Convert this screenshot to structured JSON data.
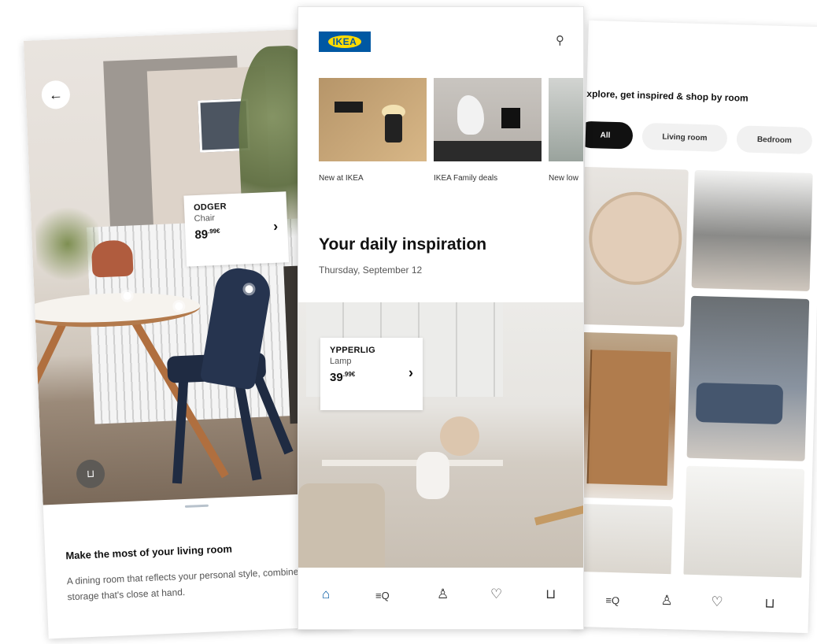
{
  "left": {
    "product": {
      "name": "ODGER",
      "type": "Chair",
      "price_main": "89",
      "price_sup": ".99€"
    },
    "title": "Make the most of your living room",
    "description": "A dining room that reflects your personal style, combined with storage that's close at hand."
  },
  "middle": {
    "logo": "IKEA",
    "categories": [
      {
        "label": "New at IKEA"
      },
      {
        "label": "IKEA Family deals"
      },
      {
        "label": "New low"
      }
    ],
    "daily_title": "Your daily inspiration",
    "daily_date": "Thursday, September 12",
    "product": {
      "name": "YPPERLIG",
      "type": "Lamp",
      "price_main": "39",
      "price_sup": ".99€"
    }
  },
  "right": {
    "title": "xplore, get inspired & shop by room",
    "pills": [
      "All",
      "Living room",
      "Bedroom"
    ]
  },
  "icons": {
    "back": "←",
    "search": "⚲",
    "home": "⌂",
    "browse": "≡Q",
    "profile": "♙",
    "wishlist": "♡",
    "cart": "⊔"
  },
  "colors": {
    "ikea_blue": "#0058a3",
    "ikea_yellow": "#ffdb00"
  }
}
